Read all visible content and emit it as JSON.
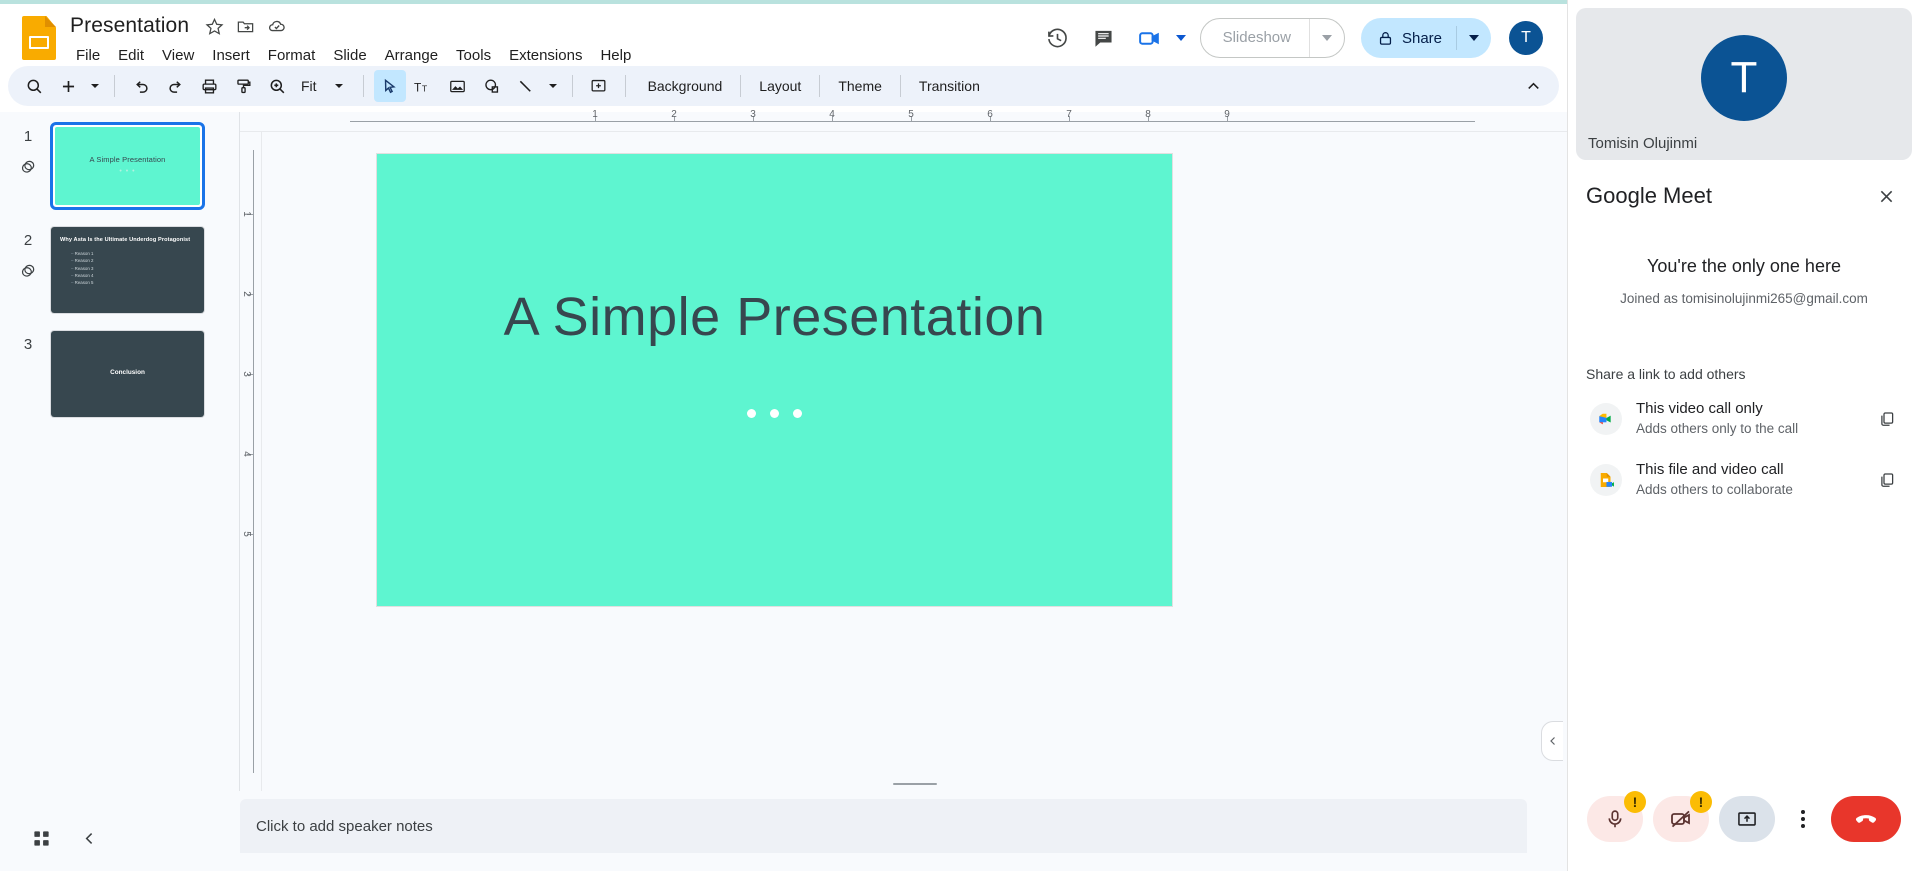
{
  "app": {
    "doc_title": "Presentation",
    "menus": [
      "File",
      "Edit",
      "View",
      "Insert",
      "Format",
      "Slide",
      "Arrange",
      "Tools",
      "Extensions",
      "Help"
    ],
    "icons": {
      "star": "star-icon",
      "move_to_folder": "move-to-folder-icon",
      "cloud_saved": "cloud-saved-icon"
    }
  },
  "header_actions": {
    "version_history": "version-history-icon",
    "comments": "comment-icon",
    "meet": "meet-camera-icon",
    "slideshow_label": "Slideshow",
    "share_label": "Share",
    "avatar_initial": "T"
  },
  "toolbar": {
    "search": "search-icon",
    "new_slide": "add-slide-icon",
    "undo": "undo-icon",
    "redo": "redo-icon",
    "print": "print-icon",
    "paint_format": "paint-format-icon",
    "zoom": "zoom-icon",
    "zoom_value": "Fit",
    "select": "select-cursor-icon",
    "textbox": "textbox-icon",
    "image": "image-icon",
    "shape": "shape-icon",
    "line": "line-icon",
    "comment_add": "add-comment-icon",
    "background_label": "Background",
    "layout_label": "Layout",
    "theme_label": "Theme",
    "transition_label": "Transition",
    "collapse": "collapse-chevron-icon"
  },
  "filmstrip": {
    "slides": [
      {
        "number": "1",
        "selected": true,
        "bg": "#5ef5d0",
        "title": "A Simple Presentation",
        "dots": "• • •",
        "type": "title"
      },
      {
        "number": "2",
        "selected": false,
        "bg": "#37474f",
        "title": "Why Asta Is the Ultimate Underdog Protagonist",
        "bullets": [
          "Reason 1",
          "Reason 2",
          "Reason 3",
          "Reason 4",
          "Reason 5"
        ],
        "type": "bullets"
      },
      {
        "number": "3",
        "selected": false,
        "bg": "#37474f",
        "title": "Conclusion",
        "type": "center"
      }
    ]
  },
  "canvas": {
    "slide_bg": "#5ef5d0",
    "title": "A Simple Presentation",
    "ruler_h_numbers": [
      "1",
      "2",
      "3",
      "4",
      "5",
      "6",
      "7",
      "8",
      "9"
    ],
    "ruler_v_numbers": [
      "1",
      "2",
      "3",
      "4",
      "5"
    ]
  },
  "notes": {
    "placeholder": "Click to add speaker notes",
    "grid_view": "grid-view-icon",
    "collapse_filmstrip": "collapse-left-icon"
  },
  "meet": {
    "tile_name": "Tomisin Olujinmi",
    "tile_initial": "T",
    "title": "Google Meet",
    "close": "close-icon",
    "status_heading": "You're the only one here",
    "joined_as": "Joined as tomisinolujinmi265@gmail.com",
    "share_section_title": "Share a link to add others",
    "links": [
      {
        "icon": "meet-app-icon",
        "title": "This video call only",
        "subtitle": "Adds others only to the call",
        "copy": "copy-link-icon"
      },
      {
        "icon": "slides-meet-icon",
        "title": "This file and video call",
        "subtitle": "Adds others to collaborate",
        "copy": "copy-link-icon"
      }
    ],
    "controls": {
      "mic": "microphone-icon",
      "mic_badge": "!",
      "camera": "camera-off-icon",
      "camera_badge": "!",
      "present": "present-screen-icon",
      "more": "more-options-icon",
      "hangup": "hang-up-icon"
    }
  },
  "colors": {
    "accent_blue": "#1a73e8",
    "share_bg": "#c2e7ff",
    "slide_teal": "#5ef5d0",
    "slide_dark": "#37474f",
    "hangup_red": "#e8362b",
    "warn_yellow": "#fbbc04"
  }
}
